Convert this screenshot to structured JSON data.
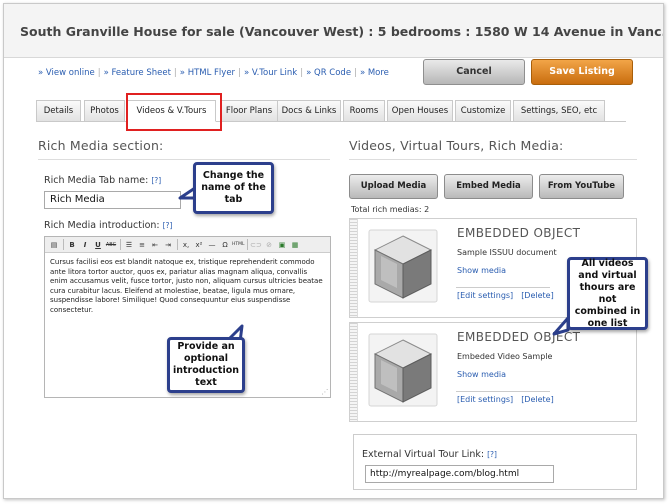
{
  "page": {
    "title": "South Granville House for sale (Vancouver West) : 5 bedrooms : 1580 W 14 Avenue in Vanc..."
  },
  "top_links": [
    "View online",
    "Feature Sheet",
    "HTML Flyer",
    "V.Tour Link",
    "QR Code",
    "More"
  ],
  "actions": {
    "cancel": "Cancel",
    "save": "Save Listing"
  },
  "tabs": [
    {
      "label": "Details",
      "active": false
    },
    {
      "label": "Photos",
      "active": false
    },
    {
      "label": "Videos & V.Tours",
      "active": true
    },
    {
      "label": "Floor Plans",
      "active": false
    },
    {
      "label": "Docs & Links",
      "active": false
    },
    {
      "label": "Rooms",
      "active": false
    },
    {
      "label": "Open Houses",
      "active": false
    },
    {
      "label": "Customize",
      "active": false
    },
    {
      "label": "Settings, SEO, etc",
      "active": false
    }
  ],
  "left": {
    "section_title": "Rich Media section:",
    "tab_name_label": "Rich Media Tab name:",
    "help": "[?]",
    "tab_name_value": "Rich  Media",
    "intro_label": "Rich Media introduction:",
    "editor_text": "Cursus facilisi eos est blandit natoque ex, tristique reprehenderit commodo ante litora tortor auctor, quos ex, pariatur alias magnam aliqua, convallis enim accusamus velit, fusce tortor, justo non, aliquam cursus ultricies beatae cura curabitur lacus. Eleifend at molestiae, beatae, ligula mus ornare, suspendisse labore! Similique! Quod consequuntur eius suspendisse consectetur."
  },
  "right": {
    "section_title": "Videos, Virtual Tours, Rich Media:",
    "buttons": [
      "Upload Media",
      "Embed Media",
      "From YouTube"
    ],
    "total": "Total rich medias: 2",
    "items": [
      {
        "title": "EMBEDDED OBJECT",
        "subtitle": "Sample ISSUU document",
        "show": "Show media",
        "edit": "[Edit settings]",
        "delete": "[Delete]"
      },
      {
        "title": "EMBEDDED OBJECT",
        "subtitle": "Embeded Video Sample",
        "show": "Show media",
        "edit": "[Edit settings]",
        "delete": "[Delete]"
      }
    ],
    "ext_label": "External Virtual Tour Link:",
    "ext_value": "http://myrealpage.com/blog.html"
  },
  "callouts": {
    "tab_name": "Change the name of the tab",
    "intro": "Provide an optional introduction text",
    "combined": "All videos and virtual thours are not combined in one list"
  },
  "colors": {
    "callout_border": "#2c3f8c",
    "highlight": "#e02020",
    "save": "#e08a22",
    "link": "#2a5db0"
  }
}
